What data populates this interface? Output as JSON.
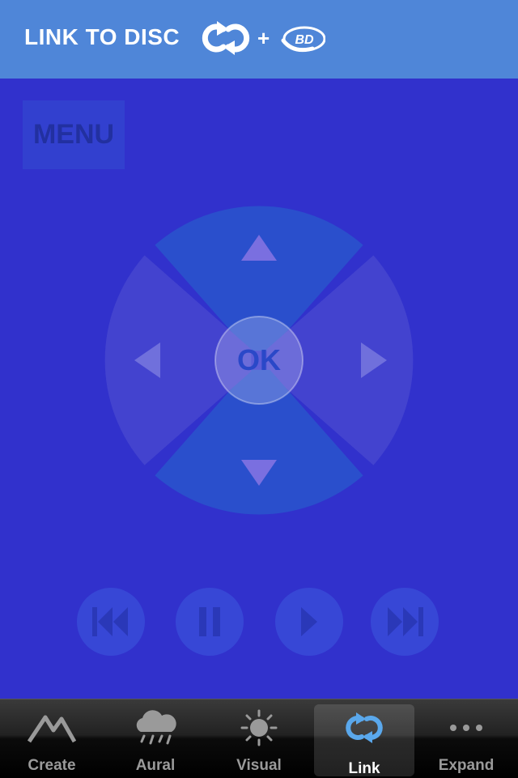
{
  "header": {
    "title": "LINK TO DISC",
    "plus": "+",
    "bd_logo_text": "BD"
  },
  "remote": {
    "menu_label": "MENU",
    "ok_label": "OK"
  },
  "colors": {
    "header_bg": "#4f86d8",
    "page_bg": "#3131cc",
    "dpad_up_down": "#2a4fcc",
    "dpad_left_right": "#4343cf"
  },
  "tabbar": {
    "tabs": [
      {
        "label": "Create",
        "icon": "mountain-icon"
      },
      {
        "label": "Aural",
        "icon": "rain-cloud-icon"
      },
      {
        "label": "Visual",
        "icon": "sun-icon"
      },
      {
        "label": "Link",
        "icon": "link-loop-icon",
        "active": true
      },
      {
        "label": "Expand",
        "icon": "more-dots-icon"
      }
    ]
  }
}
